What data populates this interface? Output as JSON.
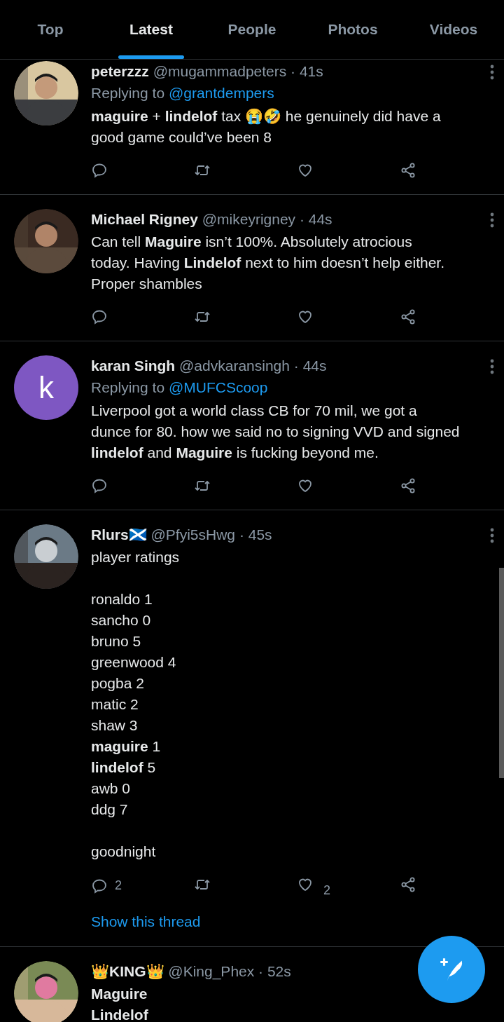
{
  "tabs": [
    {
      "label": "Top",
      "selected": false
    },
    {
      "label": "Latest",
      "selected": true
    },
    {
      "label": "People",
      "selected": false
    },
    {
      "label": "Photos",
      "selected": false
    },
    {
      "label": "Videos",
      "selected": false
    }
  ],
  "tweets": [
    {
      "avatar": {
        "kind": "picture"
      },
      "name": "peterzzz",
      "handle": "@mugammadpeters",
      "time": "· 41s",
      "replying_prefix": "Replying to",
      "replying_to": "@grantdempers",
      "paragraphs": [
        [
          "**maguire** + **lindelof** tax 😭🤣 he genuinely did have a",
          "good game could’ve been 8"
        ]
      ]
    },
    {
      "avatar": {
        "kind": "picture"
      },
      "name": "Michael Rigney",
      "handle": "@mikeyrigney",
      "time": "· 44s",
      "paragraphs": [
        [
          "Can tell **Maguire** isn’t 100%. Absolutely atrocious",
          "today. Having **Lindelof** next to him doesn’t help either.",
          "Proper shambles"
        ]
      ]
    },
    {
      "avatar": {
        "kind": "letter",
        "letter": "k",
        "color": "#7e57c2"
      },
      "name": "karan Singh",
      "handle": "@advkaransingh",
      "time": "· 44s",
      "replying_prefix": "Replying to",
      "replying_to": "@MUFCScoop",
      "paragraphs": [
        [
          "Liverpool got a world class CB for 70 mil, we got a",
          "dunce for 80. how we said no to signing VVD and signed",
          "**lindelof** and **Maguire** is fucking beyond me."
        ]
      ]
    },
    {
      "avatar": {
        "kind": "picture"
      },
      "name": "Rlurs🏴󠁧󠁢󠁳󠁣󠁴󠁿",
      "handle": "@Pfyi5sHwg",
      "time": "· 45s",
      "paragraphs": [
        [
          "player ratings"
        ],
        [
          "ronaldo 1",
          "sancho 0",
          "bruno 5",
          "greenwood 4",
          "pogba 2",
          "matic 2",
          "shaw 3",
          "**maguire** 1",
          "**lindelof** 5",
          "awb 0",
          "ddg 7"
        ],
        [
          "goodnight"
        ]
      ],
      "reply_count": "2",
      "like_count": "2",
      "thread_link": "Show this thread"
    },
    {
      "avatar": {
        "kind": "picture"
      },
      "name": "👑KING👑",
      "handle": "@King_Phex",
      "time": "· 52s",
      "paragraphs": [
        [
          "**Maguire**",
          "**Lindelof**"
        ]
      ]
    }
  ]
}
